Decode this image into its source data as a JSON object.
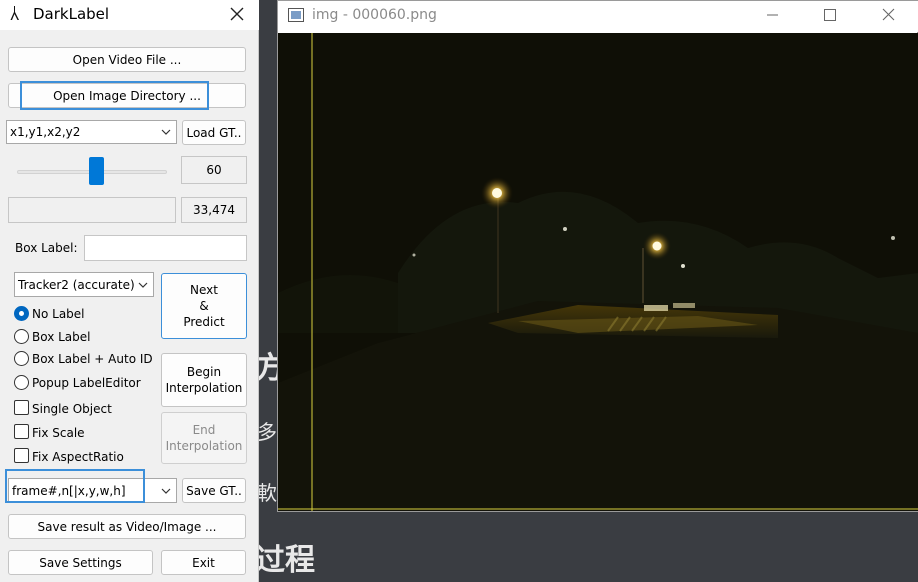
{
  "background_page": {
    "fragment_1": "",
    "fragment_2": "方",
    "fragment_3": "多",
    "fragment_4": "軟",
    "fragment_5": "过程"
  },
  "darklabel": {
    "title": "DarkLabel",
    "open_video_label": "Open Video File ...",
    "open_image_dir_label": "Open Image Directory ...",
    "gt_format": "x1,y1,x2,y2",
    "load_gt_label": "Load GT..",
    "slider_value": "60",
    "slider_fraction": 0.53,
    "total_frames": "33,474",
    "box_label_caption": "Box Label:",
    "box_label_value": "",
    "tracker_select": "Tracker2 (accurate)",
    "next_predict_lines": [
      "Next",
      "&",
      "Predict"
    ],
    "radios": [
      {
        "label": "No Label",
        "checked": true
      },
      {
        "label": "Box Label",
        "checked": false
      },
      {
        "label": "Box Label + Auto ID",
        "checked": false
      },
      {
        "label": "Popup LabelEditor",
        "checked": false
      }
    ],
    "checkboxes": [
      {
        "label": "Single Object",
        "checked": false
      },
      {
        "label": "Fix Scale",
        "checked": false
      },
      {
        "label": "Fix AspectRatio",
        "checked": false
      }
    ],
    "begin_interp_lines": [
      "Begin",
      "Interpolation"
    ],
    "end_interp_lines": [
      "End",
      "Interpolation"
    ],
    "save_format": "frame#,n[|x,y,w,h]",
    "save_gt_label": "Save GT..",
    "save_result_label": "Save result as Video/Image ...",
    "save_settings_label": "Save Settings",
    "exit_label": "Exit"
  },
  "image_window": {
    "title": "img - 000060.png"
  },
  "colors": {
    "accent_highlight": "#3c8fd9",
    "slider_thumb": "#0078d7",
    "image_background": "#0f0f06",
    "guide_line": "#d8d040"
  }
}
